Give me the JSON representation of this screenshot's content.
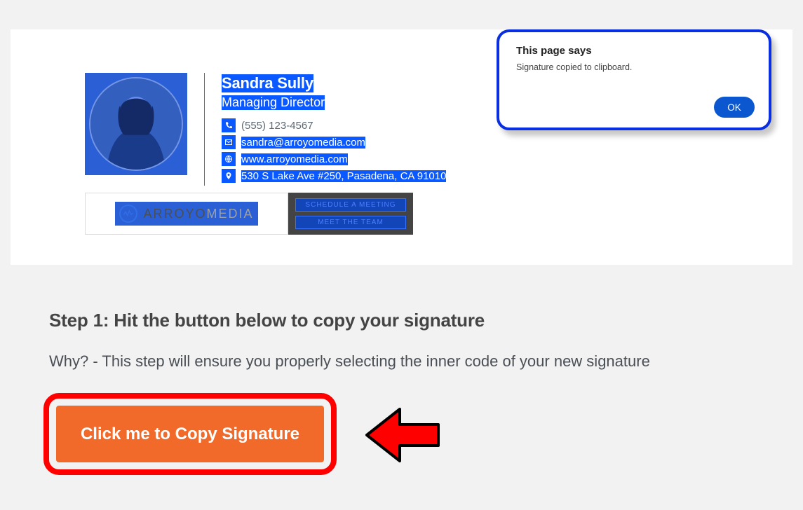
{
  "signature": {
    "name": "Sandra Sully",
    "title": "Managing Director",
    "phone": "(555) 123-4567",
    "email": "sandra@arroyomedia.com",
    "website": "www.arroyomedia.com",
    "address": "530 S Lake Ave #250, Pasadena, CA 91010",
    "logo": {
      "word1": "ARROYO",
      "word2": "MEDIA"
    },
    "buttons": {
      "meeting": "SCHEDULE A MEETING",
      "team": "MEET THE TEAM"
    }
  },
  "instructions": {
    "step_heading": "Step 1: Hit the button below to copy your signature",
    "step_desc": "Why? - This step will ensure you properly selecting the inner code of your new signature",
    "copy_button": "Click me to Copy Signature"
  },
  "alert": {
    "title": "This page says",
    "message": "Signature copied to clipboard.",
    "ok": "OK"
  }
}
